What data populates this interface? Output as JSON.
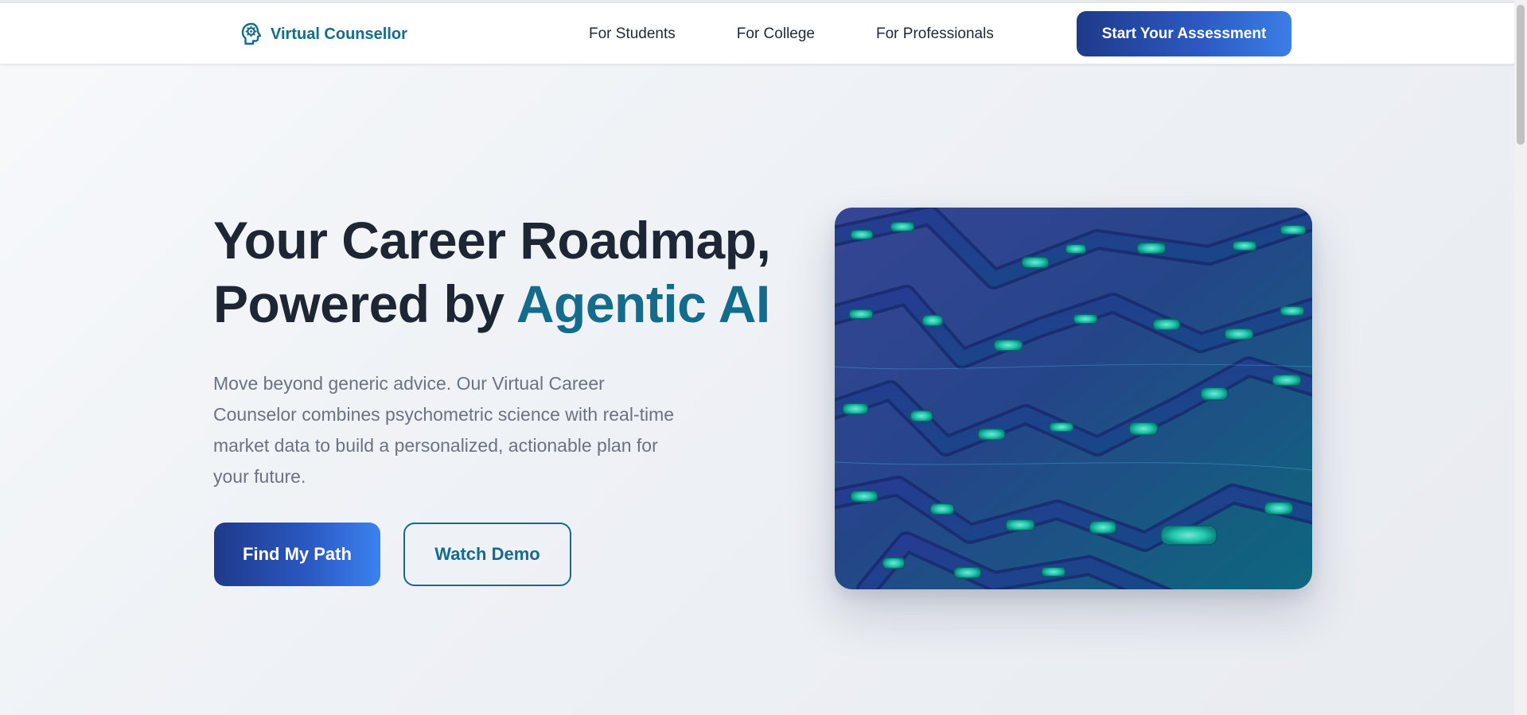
{
  "header": {
    "brand_name": "Virtual Counsellor",
    "brand_icon": "brain-head-icon",
    "nav": [
      {
        "label": "For Students"
      },
      {
        "label": "For College"
      },
      {
        "label": "For Professionals"
      }
    ],
    "cta_label": "Start Your Assessment"
  },
  "hero": {
    "title_line1": "Your Career Roadmap,",
    "title_line2_prefix": "Powered by ",
    "title_line2_accent": "Agentic AI",
    "description": "Move beyond generic advice. Our Virtual Career Counselor combines psychometric science with real-time market data to build a personalized, actionable plan for your future.",
    "primary_button": "Find My Path",
    "secondary_button": "Watch Demo",
    "image_subject": "abstract-neon-circuit-image"
  },
  "colors": {
    "brand": "#146c8c",
    "heading": "#1e2533",
    "body_text": "#6b7280",
    "button_gradient_start": "#1e3a8a",
    "button_gradient_end": "#3b82f0"
  }
}
